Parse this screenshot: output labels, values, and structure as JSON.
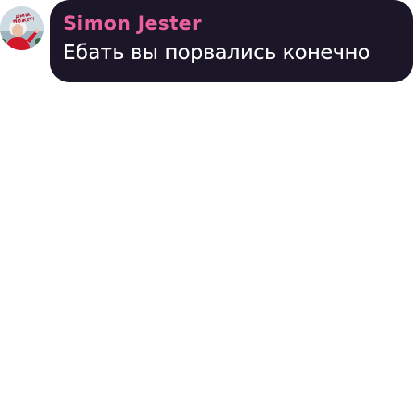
{
  "message": {
    "avatar": {
      "icon": "user-avatar-photo",
      "caption": "ДИНА МОЖЕТ!"
    },
    "sender_name": "Simon Jester",
    "text": "Ебать вы порвались конечно"
  },
  "colors": {
    "bubble_background": "#1c1728",
    "sender_name": "#e8619b",
    "message_text": "#ffffff",
    "page_background": "#ffffff"
  }
}
